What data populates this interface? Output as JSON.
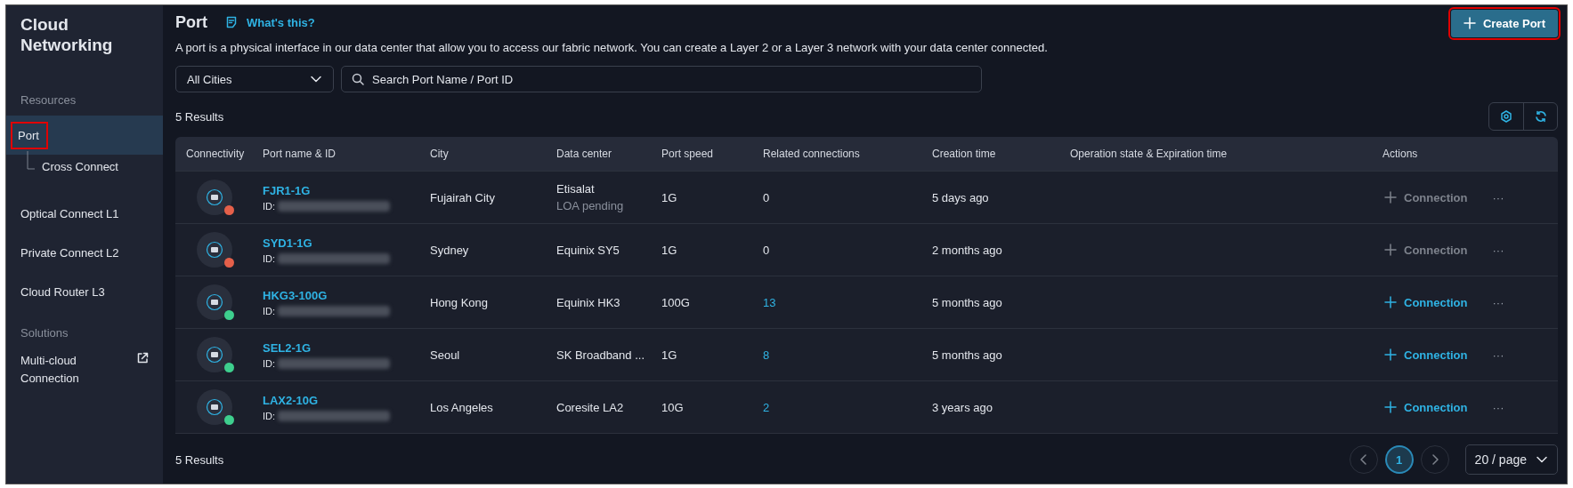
{
  "sidebar": {
    "title": "Cloud Networking",
    "sections": [
      {
        "heading": "Resources",
        "items": [
          {
            "label": "Port",
            "selected": true,
            "highlighted": true,
            "children": [
              {
                "label": "Cross Connect",
                "selected": false,
                "highlighted": false
              }
            ]
          },
          {
            "label": "Optical Connect L1",
            "selected": false,
            "highlighted": false
          },
          {
            "label": "Private Connect L2",
            "selected": false,
            "highlighted": false
          },
          {
            "label": "Cloud Router L3",
            "selected": false,
            "highlighted": false
          }
        ]
      },
      {
        "heading": "Solutions",
        "items": [
          {
            "label": "Multi-cloud Connection",
            "selected": false,
            "highlighted": false,
            "external": true
          }
        ]
      }
    ]
  },
  "header": {
    "title": "Port",
    "help_link": "What's this?",
    "description": "A port is a physical interface in our data center that allow you to access our fabric network. You can create a Layer 2 or a Layer 3 network with your data center connected.",
    "create_button": {
      "label": "Create Port",
      "highlighted": true
    }
  },
  "filters": {
    "city": "All Cities",
    "search_placeholder": "Search Port Name / Port ID"
  },
  "results_count": "5 Results",
  "table": {
    "columns": [
      "Connectivity",
      "Port name & ID",
      "City",
      "Data center",
      "Port speed",
      "Related connections",
      "Creation time",
      "Operation state & Expiration time",
      "Actions"
    ],
    "rows": [
      {
        "color": "#e5604a",
        "name": "FJR1-1G",
        "id_label": "ID:",
        "city": "Fujairah City",
        "data_center": "Etisalat",
        "data_center_note": "LOA pending",
        "speed": "1G",
        "related": "0",
        "related_link": false,
        "created": "5 days ago",
        "action": "Connection",
        "action_disabled": true,
        "more": "···"
      },
      {
        "color": "#e5604a",
        "name": "SYD1-1G",
        "id_label": "ID:",
        "city": "Sydney",
        "data_center": "Equinix SY5",
        "speed": "1G",
        "related": "0",
        "related_link": false,
        "created": "2 months ago",
        "action": "Connection",
        "action_disabled": true,
        "more": "···"
      },
      {
        "color": "#3ecf8e",
        "name": "HKG3-100G",
        "id_label": "ID:",
        "city": "Hong Kong",
        "data_center": "Equinix HK3",
        "speed": "100G",
        "related": "13",
        "related_link": true,
        "created": "5 months ago",
        "action": "Connection",
        "action_disabled": false,
        "more": "···"
      },
      {
        "color": "#3ecf8e",
        "name": "SEL2-1G",
        "id_label": "ID:",
        "city": "Seoul",
        "data_center": "SK Broadband ...",
        "speed": "1G",
        "related": "8",
        "related_link": true,
        "created": "5 months ago",
        "action": "Connection",
        "action_disabled": false,
        "more": "···"
      },
      {
        "color": "#3ecf8e",
        "name": "LAX2-10G",
        "id_label": "ID:",
        "city": "Los Angeles",
        "data_center": "Coresite LA2",
        "speed": "10G",
        "related": "2",
        "related_link": true,
        "created": "3 years ago",
        "action": "Connection",
        "action_disabled": false,
        "more": "···"
      }
    ]
  },
  "footer": {
    "results_count": "5 Results",
    "pages": [
      {
        "label": "1",
        "selected": true
      }
    ],
    "page_size": "20 / page"
  }
}
